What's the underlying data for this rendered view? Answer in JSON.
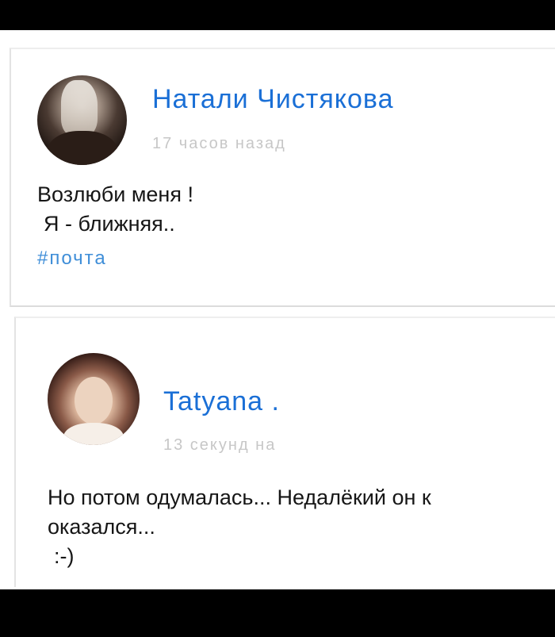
{
  "posts": [
    {
      "author": "Натали Чистякова",
      "timestamp": "17 часов назад",
      "lines": [
        "Возлюби меня !",
        "Я - ближняя.."
      ],
      "hashtag": "#почта"
    },
    {
      "author": "Tatyana .",
      "timestamp": "13 секунд на",
      "lines": [
        "Но потом одумалась... Недалёкий он к",
        "оказался...",
        ":-)"
      ]
    }
  ]
}
